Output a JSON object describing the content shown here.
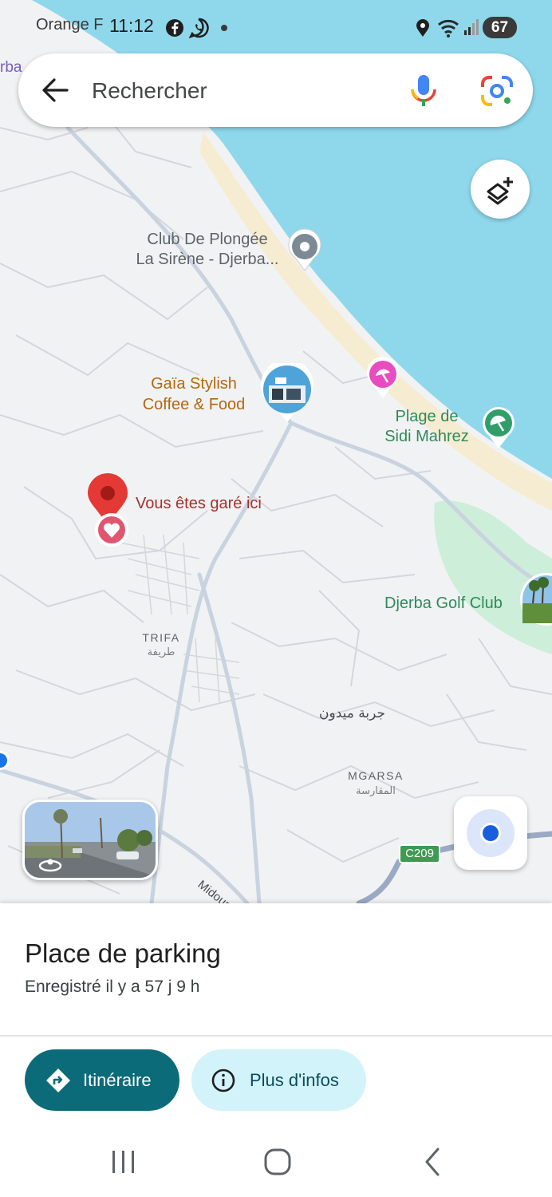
{
  "status_bar": {
    "carrier": "Orange F",
    "time": "11:12",
    "battery": "67",
    "icons": [
      "facebook-icon",
      "whatsapp-icon",
      "location-icon",
      "wifi-icon",
      "signal-icon"
    ]
  },
  "search": {
    "placeholder": "Rechercher",
    "icons": [
      "back-arrow-icon",
      "microphone-icon",
      "google-lens-icon"
    ]
  },
  "map": {
    "labels": {
      "club_plongee_line1": "Club De Plongée",
      "club_plongee_line2": "La Sirène - Djerba...",
      "gaia_line1": "Gaïa Stylish",
      "gaia_line2": "Coffee & Food",
      "plage_line1": "Plage de",
      "plage_line2": "Sidi Mahrez",
      "parked": "Vous êtes garé ici",
      "golf": "Djerba Golf Club",
      "trifa": "TRIFA",
      "trifa_ar": "طريفة",
      "djerba_midoun_ar": "جربة ميدون",
      "mgarsa": "MGARSA",
      "mgarsa_ar": "المقارسة",
      "road_c209": "C209",
      "midoun_road": "Midoun",
      "partial_left": "rba"
    },
    "colors": {
      "sea": "#8fd8ec",
      "land": "#f1f2f3",
      "golf_green": "#cdeed9",
      "beach": "#f6ecd1",
      "pin_red": "#e53935",
      "beach_pin": "#2f9e6a",
      "leisure_pin": "#e84cc0",
      "location_blue": "#1a5ee0"
    }
  },
  "bottom_sheet": {
    "title": "Place de parking",
    "subtitle": "Enregistré il y a 57 j 9 h",
    "directions_label": "Itinéraire",
    "more_info_label": "Plus d'infos"
  }
}
